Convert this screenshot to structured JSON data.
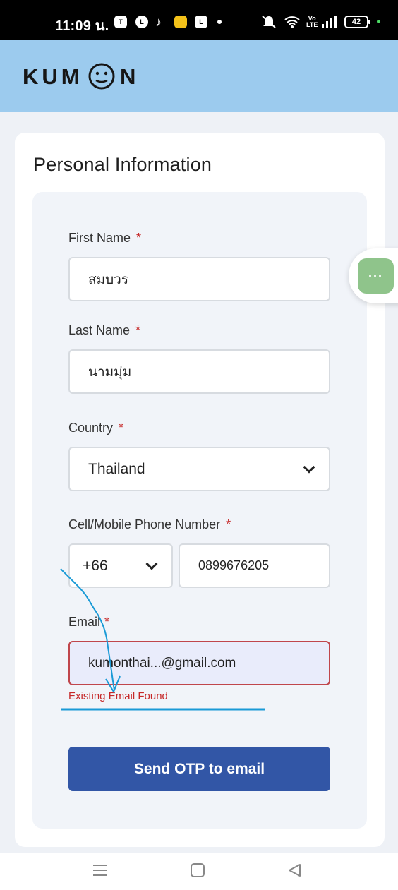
{
  "status_bar": {
    "time": "11:09 น.",
    "battery": "42",
    "icons": [
      "teams-icon",
      "line-icon",
      "tiktok-icon",
      "calendar-icon",
      "line-app-icon",
      "dot-icon",
      "mute-icon",
      "wifi-icon",
      "volte-icon",
      "signal-icon"
    ]
  },
  "header": {
    "logo_text": "KUMON"
  },
  "form": {
    "title": "Personal Information",
    "first_name": {
      "label": "First Name",
      "required": "*",
      "value": "สมบวร"
    },
    "last_name": {
      "label": "Last Name",
      "required": "*",
      "value": "นามมุ่ม"
    },
    "country": {
      "label": "Country",
      "required": "*",
      "value": "Thailand"
    },
    "phone": {
      "label": "Cell/Mobile Phone Number",
      "required": "*",
      "code": "+66",
      "number": "0899676205"
    },
    "email": {
      "label": "Email",
      "required": "*",
      "value": "kumonthai...@gmail.com",
      "error": "Existing Email Found"
    },
    "submit_label": "Send OTP to email"
  },
  "chat": {
    "icon": "chat-bubble-icon",
    "dots": "···"
  },
  "nav": {
    "icons": [
      "menu-icon",
      "home-icon",
      "back-icon"
    ]
  },
  "colors": {
    "header": "#9ccbee",
    "button": "#3256a6",
    "error": "#c62828",
    "chat": "#8fc48b",
    "annotation": "#1a9ad6"
  }
}
